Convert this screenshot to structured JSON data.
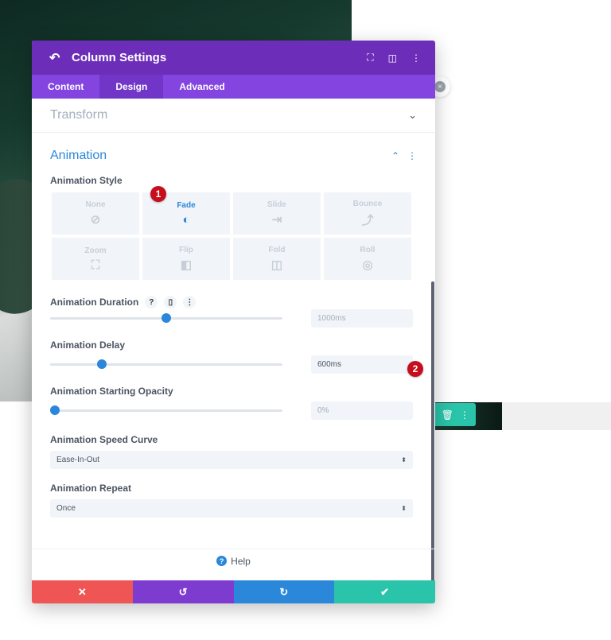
{
  "modal": {
    "title": "Column Settings",
    "tabs": [
      {
        "label": "Content"
      },
      {
        "label": "Design"
      },
      {
        "label": "Advanced"
      }
    ]
  },
  "transform": {
    "label": "Transform"
  },
  "animation": {
    "label": "Animation",
    "style_label": "Animation Style",
    "styles": [
      {
        "label": "None",
        "icon": "none-icon",
        "glyph": "⊘"
      },
      {
        "label": "Fade",
        "icon": "fade-icon",
        "glyph": "◐"
      },
      {
        "label": "Slide",
        "icon": "slide-icon",
        "glyph": "⇥"
      },
      {
        "label": "Bounce",
        "icon": "bounce-icon",
        "glyph": "⤴"
      },
      {
        "label": "Zoom",
        "icon": "zoom-icon",
        "glyph": "⛶"
      },
      {
        "label": "Flip",
        "icon": "flip-icon",
        "glyph": "◧"
      },
      {
        "label": "Fold",
        "icon": "fold-icon",
        "glyph": "◫"
      },
      {
        "label": "Roll",
        "icon": "roll-icon",
        "glyph": "◎"
      }
    ],
    "selected_style": "Fade",
    "duration": {
      "label": "Animation Duration",
      "value": "1000ms",
      "slider_fraction": 0.5
    },
    "delay": {
      "label": "Animation Delay",
      "value": "600ms",
      "slider_fraction": 0.21
    },
    "opacity": {
      "label": "Animation Starting Opacity",
      "value": "0%",
      "slider_fraction": 0.0
    },
    "speed_curve": {
      "label": "Animation Speed Curve",
      "value": "Ease-In-Out"
    },
    "repeat": {
      "label": "Animation Repeat",
      "value": "Once"
    }
  },
  "badges": {
    "one": "1",
    "two": "2"
  },
  "help": {
    "label": "Help"
  },
  "colors": {
    "titlebar": "#6c2eb9",
    "tabs": "#8344e0",
    "accent": "#2b87da",
    "cancel": "#ef5555",
    "undo": "#7e3bd0",
    "redo": "#2b87da",
    "save": "#29c4a9",
    "badge": "#c60e1d"
  }
}
